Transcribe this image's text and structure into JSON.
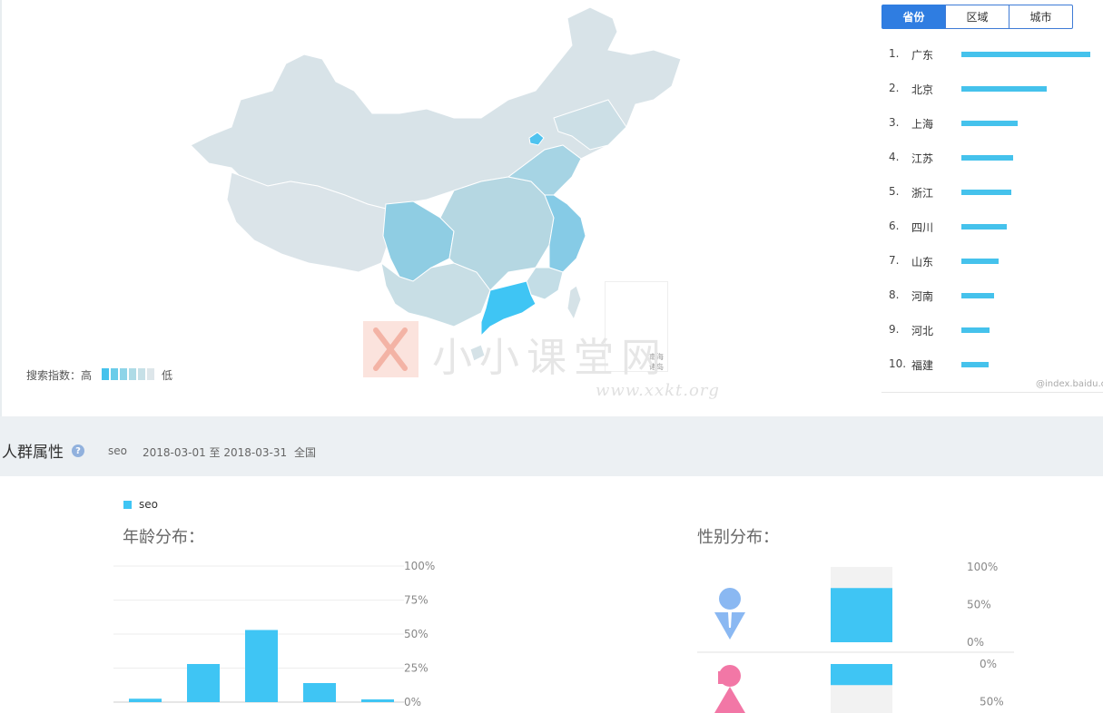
{
  "map": {
    "legend_label": "搜索指数：高",
    "legend_low": "低",
    "legend_colors": [
      "#45c2ec",
      "#6acce9",
      "#8ed4e8",
      "#aedbe6",
      "#c6e0e7",
      "#dde6ea"
    ],
    "south_sea_label": "南海诸岛"
  },
  "watermark": {
    "text": "小小课堂网",
    "url": "www.xxkt.org"
  },
  "ranking": {
    "tabs": [
      {
        "label": "省份",
        "active": true
      },
      {
        "label": "区域",
        "active": false
      },
      {
        "label": "城市",
        "active": false
      }
    ],
    "items": [
      {
        "rank": "1.",
        "name": "广东",
        "value": 100
      },
      {
        "rank": "2.",
        "name": "北京",
        "value": 66
      },
      {
        "rank": "3.",
        "name": "上海",
        "value": 44
      },
      {
        "rank": "4.",
        "name": "江苏",
        "value": 40
      },
      {
        "rank": "5.",
        "name": "浙江",
        "value": 39
      },
      {
        "rank": "6.",
        "name": "四川",
        "value": 35
      },
      {
        "rank": "7.",
        "name": "山东",
        "value": 29
      },
      {
        "rank": "8.",
        "name": "河南",
        "value": 25
      },
      {
        "rank": "9.",
        "name": "河北",
        "value": 22
      },
      {
        "rank": "10.",
        "name": "福建",
        "value": 21
      }
    ],
    "credit": "@index.baidu.c"
  },
  "section": {
    "title": "人群属性",
    "help": "?",
    "keyword": "seo",
    "date_range": "2018-03-01 至 2018-03-31",
    "region": "全国"
  },
  "legend": {
    "series_name": "seo"
  },
  "chart_data": [
    {
      "type": "bar",
      "title": "年龄分布：",
      "categories": [
        "",
        "",
        "",
        "",
        ""
      ],
      "series": [
        {
          "name": "seo",
          "values": [
            2.5,
            28,
            53,
            14,
            2
          ]
        }
      ],
      "ylim": [
        0,
        100
      ],
      "yticks": [
        "100%",
        "75%",
        "50%",
        "25%",
        "0%"
      ],
      "color": "#3fc5f4"
    },
    {
      "type": "bar",
      "title": "性别分布：",
      "categories": [
        "male",
        "female"
      ],
      "series": [
        {
          "name": "seo",
          "values": [
            72,
            28
          ]
        }
      ],
      "ylim": [
        0,
        100
      ],
      "yticks_top": [
        "100%",
        "50%",
        "0%"
      ],
      "yticks_bottom": [
        "0%",
        "50%"
      ],
      "color": "#3fc5f4",
      "male_icon_color": "#8ab8f2",
      "female_icon_color": "#f277a6"
    }
  ]
}
